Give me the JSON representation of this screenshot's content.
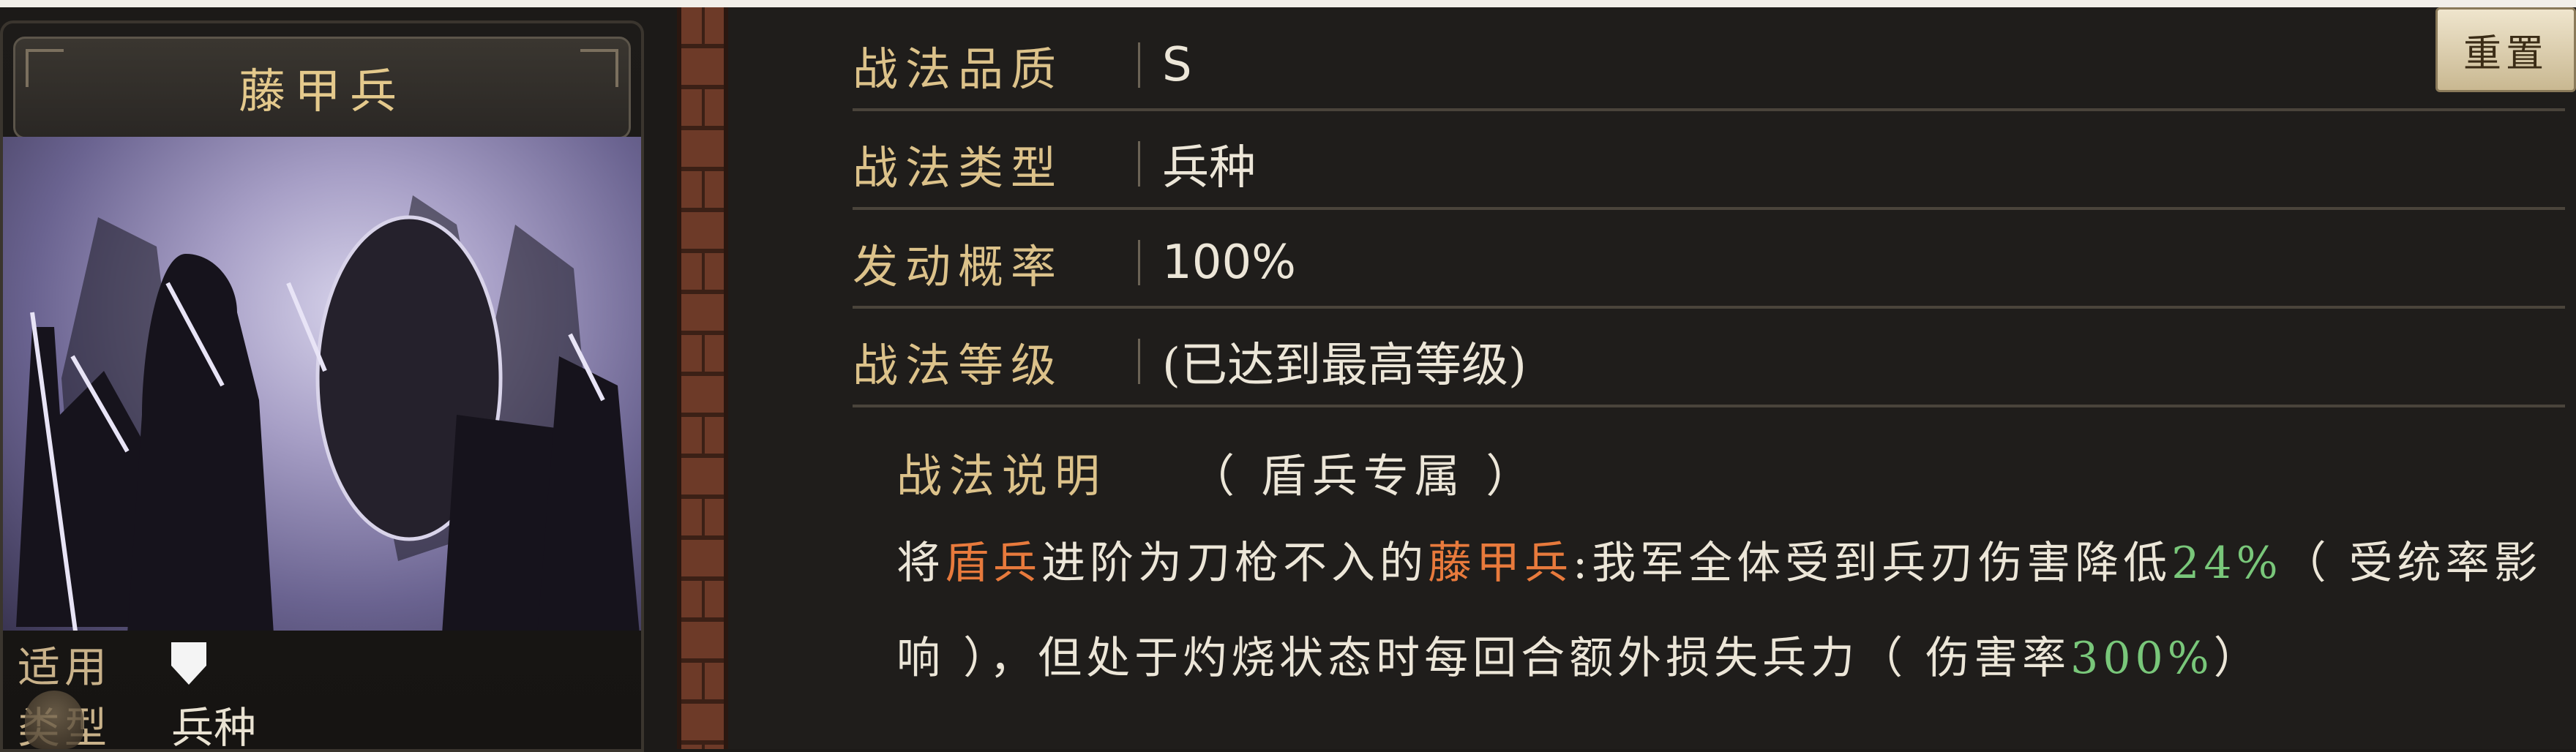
{
  "card": {
    "name": "藤甲兵",
    "apply_label": "适用",
    "type_label": "类型",
    "type_value": "兵种",
    "shield_icon": "shield-icon"
  },
  "reset_button": {
    "label": "重置"
  },
  "skill": {
    "rows": [
      {
        "key": "战法品质",
        "value": "S"
      },
      {
        "key": "战法类型",
        "value": "兵种"
      },
      {
        "key": "发动概率",
        "value": "100%"
      },
      {
        "key": "战法等级",
        "value": "(已达到最高等级)"
      }
    ],
    "desc_label": "战法说明",
    "desc_tag": "（ 盾兵专属 ）",
    "desc_parts": {
      "p1": "将",
      "p2": "盾兵",
      "p3": "进阶为刀枪不入的",
      "p4": "藤甲兵",
      "p5": ":我军全体受到兵刃伤害降低",
      "p6": "24%",
      "p7": "（ 受统率影响 ），但处于灼烧状态时每回合额外损失兵力（ 伤害率",
      "p8": "300%",
      "p9": "）"
    }
  },
  "colors": {
    "gold": "#dcc28a",
    "highlight": "#e87a3c",
    "number": "#79c77a"
  }
}
